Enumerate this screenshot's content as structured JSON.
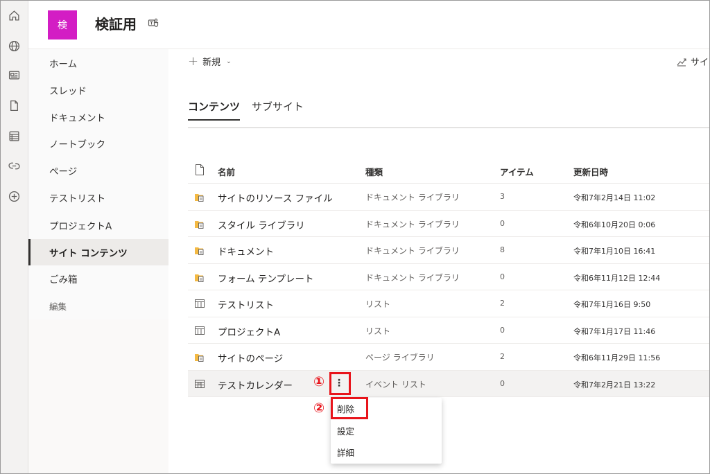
{
  "header": {
    "logo_letter": "検",
    "site_title": "検証用",
    "logo_color": "#d31dc4"
  },
  "appbar": {
    "icons": [
      "home-icon",
      "globe-icon",
      "news-icon",
      "document-icon",
      "list-icon",
      "link-icon",
      "add-circle-icon"
    ]
  },
  "leftnav": {
    "items": [
      {
        "label": "ホーム"
      },
      {
        "label": "スレッド"
      },
      {
        "label": "ドキュメント"
      },
      {
        "label": "ノートブック"
      },
      {
        "label": "ページ"
      },
      {
        "label": "テストリスト"
      },
      {
        "label": "プロジェクトA"
      },
      {
        "label": "サイト コンテンツ"
      },
      {
        "label": "ごみ箱"
      },
      {
        "label": "編集"
      }
    ],
    "active_index": 7
  },
  "commandbar": {
    "new_label": "新規",
    "site_stats_label": "サイ"
  },
  "tabs": [
    {
      "label": "コンテンツ",
      "active": true
    },
    {
      "label": "サブサイト",
      "active": false
    }
  ],
  "table": {
    "headers": {
      "name": "名前",
      "type": "種類",
      "items": "アイテム",
      "modified": "更新日時"
    },
    "rows": [
      {
        "icon": "library-icon",
        "name": "サイトのリソース ファイル",
        "type": "ドキュメント ライブラリ",
        "items": "3",
        "modified": "令和7年2月14日 11:02"
      },
      {
        "icon": "library-icon",
        "name": "スタイル ライブラリ",
        "type": "ドキュメント ライブラリ",
        "items": "0",
        "modified": "令和6年10月20日 0:06"
      },
      {
        "icon": "library-icon",
        "name": "ドキュメント",
        "type": "ドキュメント ライブラリ",
        "items": "8",
        "modified": "令和7年1月10日 16:41"
      },
      {
        "icon": "library-icon",
        "name": "フォーム テンプレート",
        "type": "ドキュメント ライブラリ",
        "items": "0",
        "modified": "令和6年11月12日 12:44"
      },
      {
        "icon": "list-icon",
        "name": "テストリスト",
        "type": "リスト",
        "items": "2",
        "modified": "令和7年1月16日 9:50"
      },
      {
        "icon": "list-icon",
        "name": "プロジェクトA",
        "type": "リスト",
        "items": "0",
        "modified": "令和7年1月17日 11:46"
      },
      {
        "icon": "library-icon",
        "name": "サイトのページ",
        "type": "ページ ライブラリ",
        "items": "2",
        "modified": "令和6年11月29日 11:56"
      },
      {
        "icon": "calendar-icon",
        "name": "テストカレンダー",
        "type": "イベント リスト",
        "items": "0",
        "modified": "令和7年2月21日 13:22"
      }
    ]
  },
  "context_menu": {
    "items": [
      {
        "label": "削除"
      },
      {
        "label": "設定"
      },
      {
        "label": "詳細"
      }
    ]
  },
  "annotations": {
    "step1": "①",
    "step2": "②",
    "color": "#e8141b"
  }
}
